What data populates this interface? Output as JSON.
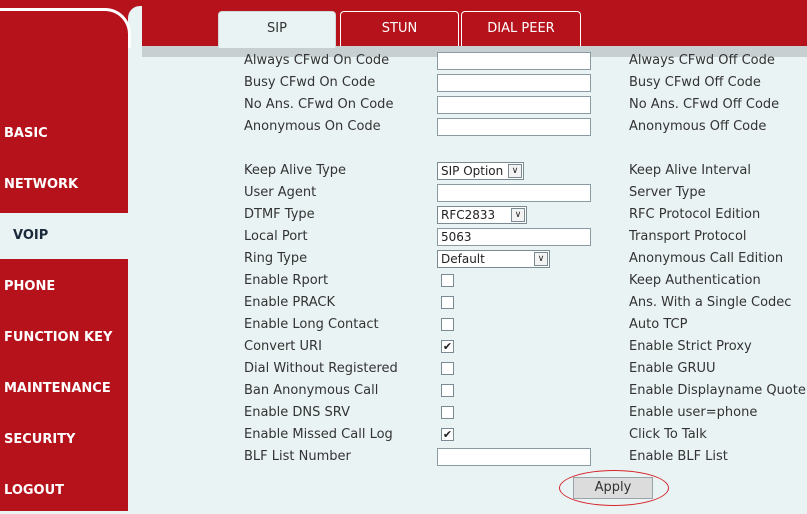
{
  "sidebar": {
    "items": [
      {
        "label": "BASIC"
      },
      {
        "label": "NETWORK"
      },
      {
        "label": "VOIP"
      },
      {
        "label": "PHONE"
      },
      {
        "label": "FUNCTION KEY"
      },
      {
        "label": "MAINTENANCE"
      },
      {
        "label": "SECURITY"
      },
      {
        "label": "LOGOUT"
      }
    ],
    "active": "VOIP"
  },
  "tabs": [
    {
      "label": "SIP",
      "active": true
    },
    {
      "label": "STUN",
      "active": false
    },
    {
      "label": "DIAL PEER",
      "active": false
    }
  ],
  "form": {
    "rows": [
      {
        "left": "Always CFwd On Code",
        "right": "Always CFwd Off Code",
        "control": "text",
        "value": ""
      },
      {
        "left": "Busy CFwd On Code",
        "right": "Busy CFwd Off Code",
        "control": "text",
        "value": ""
      },
      {
        "left": "No Ans. CFwd On Code",
        "right": "No Ans. CFwd Off Code",
        "control": "text",
        "value": ""
      },
      {
        "left": "Anonymous On Code",
        "right": "Anonymous Off Code",
        "control": "text",
        "value": ""
      },
      {
        "left": "Keep Alive Type",
        "right": "Keep Alive Interval",
        "control": "select",
        "value": "SIP Option"
      },
      {
        "left": "User Agent",
        "right": "Server Type",
        "control": "text",
        "value": ""
      },
      {
        "left": "DTMF Type",
        "right": "RFC Protocol Edition",
        "control": "select",
        "value": "RFC2833"
      },
      {
        "left": "Local Port",
        "right": "Transport Protocol",
        "control": "text",
        "value": "5063"
      },
      {
        "left": "Ring Type",
        "right": "Anonymous Call Edition",
        "control": "select",
        "value": "Default"
      },
      {
        "left": "Enable Rport",
        "right": "Keep Authentication",
        "control": "checkbox",
        "checked": false
      },
      {
        "left": "Enable PRACK",
        "right": "Ans. With a Single Codec",
        "control": "checkbox",
        "checked": false
      },
      {
        "left": "Enable Long Contact",
        "right": "Auto TCP",
        "control": "checkbox",
        "checked": false
      },
      {
        "left": "Convert URI",
        "right": "Enable Strict Proxy",
        "control": "checkbox",
        "checked": true
      },
      {
        "left": "Dial Without Registered",
        "right": "Enable GRUU",
        "control": "checkbox",
        "checked": false
      },
      {
        "left": "Ban Anonymous Call",
        "right": "Enable Displayname Quote",
        "control": "checkbox",
        "checked": false
      },
      {
        "left": "Enable DNS SRV",
        "right": "Enable user=phone",
        "control": "checkbox",
        "checked": false
      },
      {
        "left": "Enable Missed Call Log",
        "right": "Click To Talk",
        "control": "checkbox",
        "checked": true
      },
      {
        "left": "BLF List Number",
        "right": "Enable BLF List",
        "control": "text",
        "value": ""
      }
    ]
  },
  "apply_label": "Apply",
  "colors": {
    "brand_red": "#b5121b",
    "background": "#eaf3f4",
    "highlight_ring": "#d4262c"
  },
  "icons": {
    "select_arrow": "chevron-down-icon",
    "checkmark": "checkmark-icon"
  }
}
